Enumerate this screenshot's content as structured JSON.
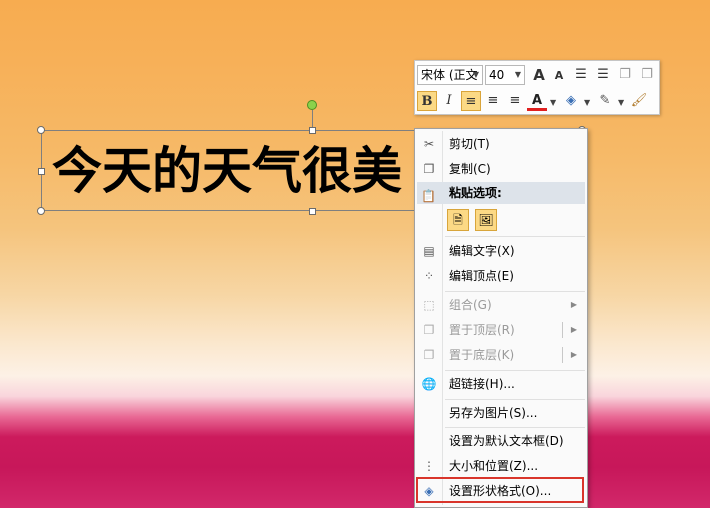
{
  "slide": {
    "text": "今天的天气很美"
  },
  "mini_toolbar": {
    "font_name": "宋体 (正文",
    "font_size": "40",
    "grow_font": "A",
    "shrink_font": "A",
    "bold": "B",
    "italic": "I",
    "font_color_label": "A"
  },
  "context_menu": {
    "cut": "剪切(T)",
    "copy": "复制(C)",
    "paste_options": "粘贴选项:",
    "edit_text": "编辑文字(X)",
    "edit_points": "编辑顶点(E)",
    "group": "组合(G)",
    "bring_to_front": "置于顶层(R)",
    "send_to_back": "置于底层(K)",
    "hyperlink": "超链接(H)...",
    "save_as_picture": "另存为图片(S)...",
    "set_default_textbox": "设置为默认文本框(D)",
    "size_position": "大小和位置(Z)...",
    "format_shape": "设置形状格式(O)..."
  },
  "colors": {
    "highlight_border": "#d9352b",
    "active_button": "#fbd985"
  }
}
